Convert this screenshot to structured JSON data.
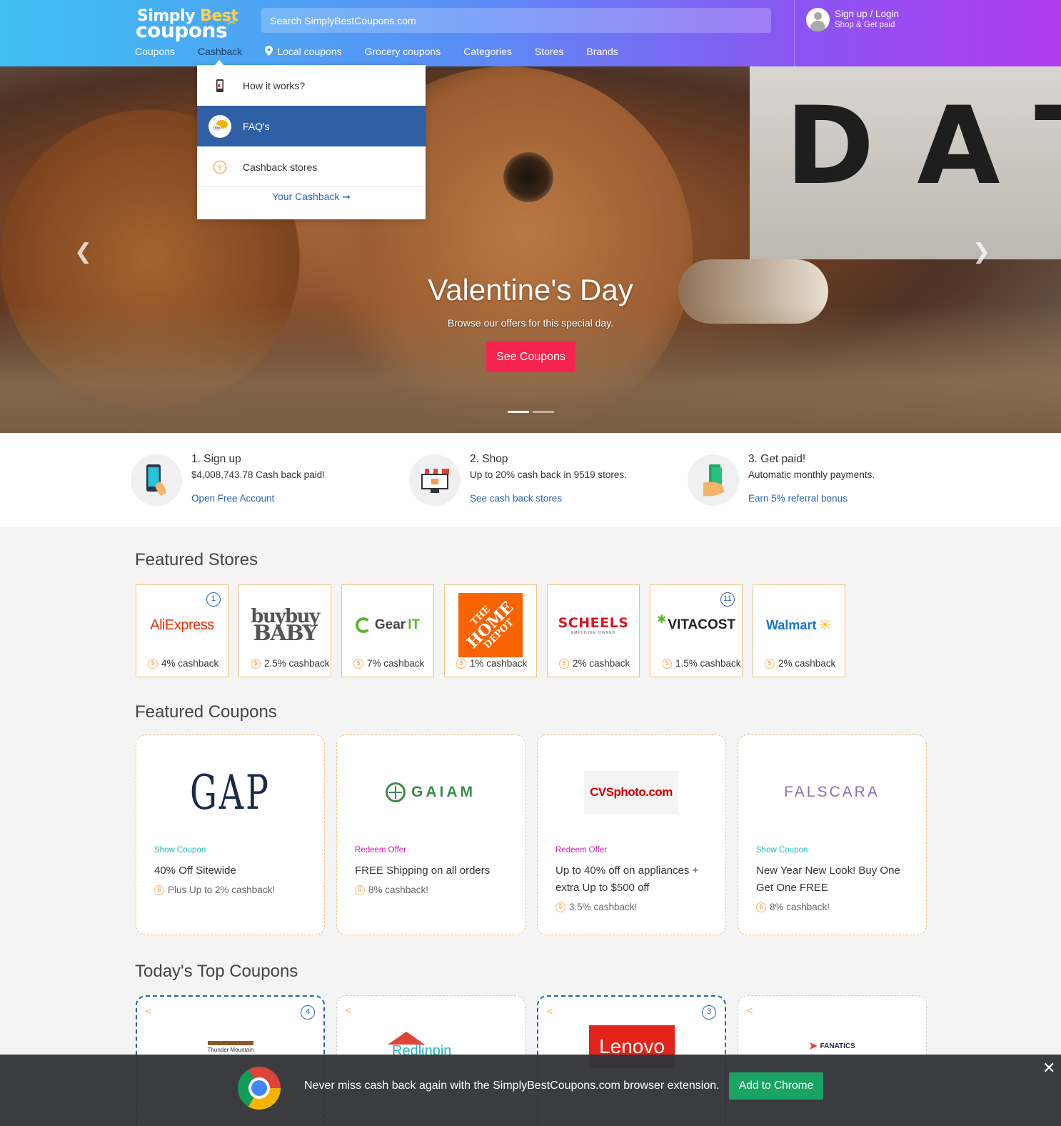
{
  "header": {
    "logo_line1a": "Simply",
    "logo_line1b": "Best",
    "logo_line2": "coupons",
    "search_placeholder": "Search SimplyBestCoupons.com",
    "signup": "Sign up / Login",
    "signup_sub": "Shop & Get paid"
  },
  "nav": {
    "items": [
      "Coupons",
      "Cashback",
      "Local coupons",
      "Grocery coupons",
      "Categories",
      "Stores",
      "Brands"
    ],
    "active": "Cashback"
  },
  "dropdown": {
    "items": [
      {
        "label": "How it works?",
        "icon": "phone-icon"
      },
      {
        "label": "FAQ's",
        "icon": "chat-bubble-icon"
      },
      {
        "label": "Cashback stores",
        "icon": "coin-icon"
      }
    ],
    "selected": "FAQ's",
    "link": "Your Cashback",
    "link_arrow": "➞"
  },
  "hero": {
    "title": "Valentine's Day",
    "subtitle": "Browse our offers for this special day.",
    "button": "See Coupons",
    "sign_text": "DATE",
    "slides": 2,
    "current_slide": 1
  },
  "steps": [
    {
      "title": "1. Sign up",
      "desc": "$4,008,743.78 Cash back paid!",
      "link": "Open Free Account",
      "icon": "phone-tap-icon"
    },
    {
      "title": "2. Shop",
      "desc": "Up to 20% cash back in 9519 stores.",
      "link": "See cash back stores",
      "icon": "storefront-icon"
    },
    {
      "title": "3. Get paid!",
      "desc": "Automatic monthly payments.",
      "link": "Earn 5% referral bonus",
      "icon": "money-hand-icon"
    }
  ],
  "featured_stores": {
    "title": "Featured Stores",
    "stores": [
      {
        "name": "AliExpress",
        "cashback": "4% cashback",
        "badge": "1"
      },
      {
        "name": "buybuy BABY",
        "name_l1": "buybuy",
        "name_l2": "BABY",
        "cashback": "2.5% cashback",
        "badge": ""
      },
      {
        "name": "Gear IT",
        "name_a": "Gear",
        "name_b": "IT",
        "cashback": "7% cashback",
        "badge": ""
      },
      {
        "name": "The Home Depot",
        "name_l1": "THE",
        "name_l2": "HOME",
        "name_l3": "DEPOT",
        "cashback": "1% cashback",
        "badge": ""
      },
      {
        "name": "SCHEELS",
        "sub": "EMPLOYEE OWNED",
        "cashback": "2% cashback",
        "badge": ""
      },
      {
        "name": "VITACOST",
        "cashback": "1.5% cashback",
        "badge": "11"
      },
      {
        "name": "Walmart",
        "cashback": "2% cashback",
        "badge": ""
      }
    ]
  },
  "featured_coupons": {
    "title": "Featured Coupons",
    "coupons": [
      {
        "brand": "GAP",
        "kind": "Show Coupon",
        "title": "40% Off Sitewide",
        "extra": "Plus Up to 2% cashback!"
      },
      {
        "brand": "GAIAM",
        "kind": "Redeem Offer",
        "title": "FREE Shipping on all orders",
        "extra": "8% cashback!"
      },
      {
        "brand": "CVSphoto.com",
        "kind": "Redeem Offer",
        "title": "Up to 40% off on appliances + extra Up to $500 off",
        "extra": "3.5% cashback!"
      },
      {
        "brand": "FALSCARA",
        "kind": "Show Coupon",
        "title": "New Year New Look! Buy One Get One FREE",
        "extra": "8% cashback!"
      }
    ]
  },
  "top_coupons": {
    "title": "Today's Top Coupons",
    "cards": [
      {
        "brand": "Thunder Mountain",
        "badge": "4"
      },
      {
        "brand": "Redlinpin",
        "badge": ""
      },
      {
        "brand": "Lenovo",
        "badge": "3"
      },
      {
        "brand": "FANATICS",
        "badge": ""
      }
    ]
  },
  "extension_bar": {
    "text": "Never miss cash back again with the SimplyBestCoupons.com browser extension.",
    "button": "Add to Chrome",
    "close": "✕"
  },
  "colors": {
    "header_start": "#3ec0f2",
    "header_end": "#b23cf0",
    "accent_blue": "#2a62b3",
    "hero_button": "#f5244e",
    "store_border": "#f2c27d",
    "add_chrome": "#19a463"
  }
}
